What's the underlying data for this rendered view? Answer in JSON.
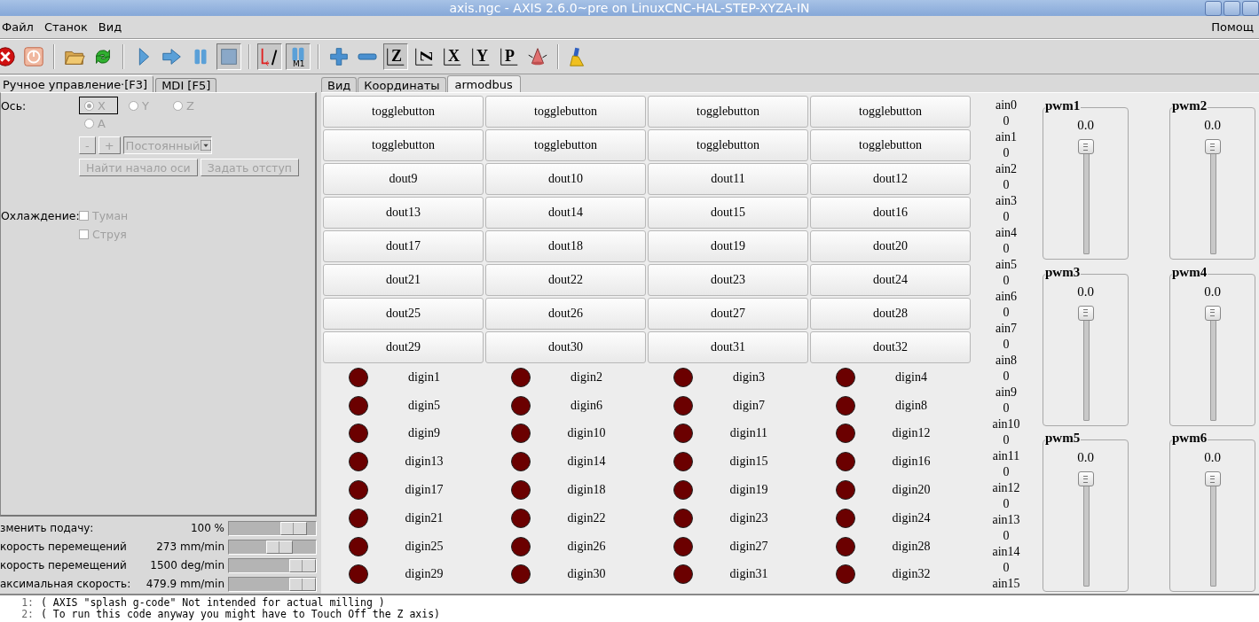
{
  "window": {
    "title": "axis.ngc - AXIS 2.6.0~pre on LinuxCNC-HAL-STEP-XYZA-IN"
  },
  "menu": [
    "Файл",
    "Станок",
    "Вид"
  ],
  "menu_right": "Помощ",
  "toolbar": [
    {
      "kind": "estop",
      "pressed": false
    },
    {
      "kind": "power",
      "pressed": false
    },
    {
      "kind": "sep"
    },
    {
      "kind": "open",
      "pressed": false
    },
    {
      "kind": "reload",
      "pressed": false
    },
    {
      "kind": "sep"
    },
    {
      "kind": "run",
      "pressed": false
    },
    {
      "kind": "step",
      "pressed": false
    },
    {
      "kind": "pause",
      "pressed": false
    },
    {
      "kind": "stop",
      "pressed": true
    },
    {
      "kind": "sep"
    },
    {
      "kind": "blockdelete",
      "pressed": true
    },
    {
      "kind": "optstop",
      "label": "M1",
      "pressed": true
    },
    {
      "kind": "sep"
    },
    {
      "kind": "zoomin",
      "pressed": false
    },
    {
      "kind": "zoomout",
      "pressed": false
    },
    {
      "kind": "view",
      "label": "Z",
      "pressed": true
    },
    {
      "kind": "view2",
      "label": "Z",
      "pressed": false
    },
    {
      "kind": "view",
      "label": "X",
      "pressed": false
    },
    {
      "kind": "view",
      "label": "Y",
      "pressed": false
    },
    {
      "kind": "viewp",
      "label": "P",
      "pressed": false
    },
    {
      "kind": "rotate",
      "pressed": false
    },
    {
      "kind": "sep"
    },
    {
      "kind": "clear",
      "pressed": false
    }
  ],
  "left_tabs": [
    {
      "label": "Ручное управление·[F3]",
      "selected": true
    },
    {
      "label": "MDI [F5]",
      "selected": false
    }
  ],
  "manual": {
    "disabled": true,
    "axis_label": "Ось:",
    "axes": [
      {
        "label": "X",
        "selected": true
      },
      {
        "label": "Y",
        "selected": false
      },
      {
        "label": "Z",
        "selected": false
      },
      {
        "label": "A",
        "selected": false
      }
    ],
    "minus": "-",
    "plus": "+",
    "jog_mode": "Постоянный",
    "home_button": "Найти начало оси",
    "touch_off_button": "Задать отступ",
    "coolant_label": "Охлаждение:",
    "coolant": [
      {
        "label": "Туман",
        "checked": false
      },
      {
        "label": "Струя",
        "checked": false
      }
    ]
  },
  "overrides": [
    {
      "label": "зменить подачу:",
      "reading": "100 %",
      "level": 0.85
    },
    {
      "label": "корость перемещений",
      "reading": "273 mm/min",
      "level": 0.62
    },
    {
      "label": "корость перемещений",
      "reading": "1500 deg/min",
      "level": 1
    },
    {
      "label": "аксимальная скорость:",
      "reading": "479.9 mm/min",
      "level": 1
    }
  ],
  "right_tabs": [
    {
      "label": "Вид",
      "selected": false
    },
    {
      "label": "Координаты",
      "selected": false
    },
    {
      "label": "armodbus",
      "selected": true
    }
  ],
  "buttons": [
    "togglebutton",
    "togglebutton",
    "togglebutton",
    "togglebutton",
    "togglebutton",
    "togglebutton",
    "togglebutton",
    "togglebutton",
    "dout9",
    "dout10",
    "dout11",
    "dout12",
    "dout13",
    "dout14",
    "dout15",
    "dout16",
    "dout17",
    "dout18",
    "dout19",
    "dout20",
    "dout21",
    "dout22",
    "dout23",
    "dout24",
    "dout25",
    "dout26",
    "dout27",
    "dout28",
    "dout29",
    "dout30",
    "dout31",
    "dout32"
  ],
  "digins": [
    {
      "label": "digin1",
      "on": false
    },
    {
      "label": "digin2",
      "on": false
    },
    {
      "label": "digin3",
      "on": false
    },
    {
      "label": "digin4",
      "on": false
    },
    {
      "label": "digin5",
      "on": false
    },
    {
      "label": "digin6",
      "on": false
    },
    {
      "label": "digin7",
      "on": false
    },
    {
      "label": "digin8",
      "on": false
    },
    {
      "label": "digin9",
      "on": false
    },
    {
      "label": "digin10",
      "on": false
    },
    {
      "label": "digin11",
      "on": false
    },
    {
      "label": "digin12",
      "on": false
    },
    {
      "label": "digin13",
      "on": false
    },
    {
      "label": "digin14",
      "on": false
    },
    {
      "label": "digin15",
      "on": false
    },
    {
      "label": "digin16",
      "on": false
    },
    {
      "label": "digin17",
      "on": false
    },
    {
      "label": "digin18",
      "on": false
    },
    {
      "label": "digin19",
      "on": false
    },
    {
      "label": "digin20",
      "on": false
    },
    {
      "label": "digin21",
      "on": false
    },
    {
      "label": "digin22",
      "on": false
    },
    {
      "label": "digin23",
      "on": false
    },
    {
      "label": "digin24",
      "on": false
    },
    {
      "label": "digin25",
      "on": false
    },
    {
      "label": "digin26",
      "on": false
    },
    {
      "label": "digin27",
      "on": false
    },
    {
      "label": "digin28",
      "on": false
    },
    {
      "label": "digin29",
      "on": false
    },
    {
      "label": "digin30",
      "on": false
    },
    {
      "label": "digin31",
      "on": false
    },
    {
      "label": "digin32",
      "on": false
    }
  ],
  "ains": [
    {
      "label": "ain0",
      "value": "0"
    },
    {
      "label": "ain1",
      "value": "0"
    },
    {
      "label": "ain2",
      "value": "0"
    },
    {
      "label": "ain3",
      "value": "0"
    },
    {
      "label": "ain4",
      "value": "0"
    },
    {
      "label": "ain5",
      "value": "0"
    },
    {
      "label": "ain6",
      "value": "0"
    },
    {
      "label": "ain7",
      "value": "0"
    },
    {
      "label": "ain8",
      "value": "0"
    },
    {
      "label": "ain9",
      "value": "0"
    },
    {
      "label": "ain10",
      "value": "0"
    },
    {
      "label": "ain11",
      "value": "0"
    },
    {
      "label": "ain12",
      "value": "0"
    },
    {
      "label": "ain13",
      "value": "0"
    },
    {
      "label": "ain14",
      "value": "0"
    },
    {
      "label": "ain15"
    }
  ],
  "pwms": [
    {
      "label": "pwm1",
      "reading": "0.0"
    },
    {
      "label": "pwm2",
      "reading": "0.0"
    },
    {
      "label": "pwm3",
      "reading": "0.0"
    },
    {
      "label": "pwm4",
      "reading": "0.0"
    },
    {
      "label": "pwm5",
      "reading": "0.0"
    },
    {
      "label": "pwm6",
      "reading": "0.0"
    }
  ],
  "code_lines": [
    {
      "number": "1:",
      "text": "( AXIS \"splash g-code\" Not intended for actual milling )"
    },
    {
      "number": "2:",
      "text": "( To run this code anyway you might have to Touch Off the Z axis)"
    }
  ]
}
